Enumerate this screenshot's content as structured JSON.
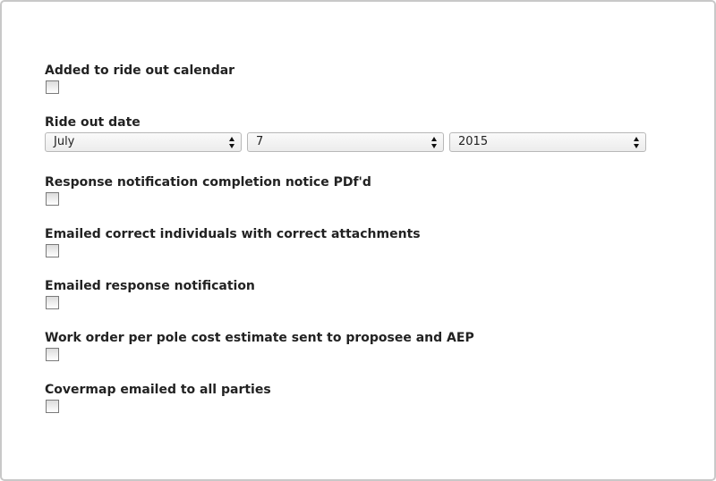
{
  "form": {
    "added_to_calendar": {
      "label": "Added to ride out calendar",
      "checked": false
    },
    "ride_out_date": {
      "label": "Ride out date",
      "month": "July",
      "day": "7",
      "year": "2015"
    },
    "response_pdf": {
      "label": "Response notification completion notice PDf'd",
      "checked": false
    },
    "emailed_individuals": {
      "label": "Emailed correct individuals with correct attachments",
      "checked": false
    },
    "emailed_response": {
      "label": "Emailed response notification",
      "checked": false
    },
    "work_order": {
      "label": "Work order per pole cost estimate sent to proposee and AEP",
      "checked": false
    },
    "covermap": {
      "label": "Covermap emailed to all parties",
      "checked": false
    }
  },
  "icons": {
    "select_arrows": "up-down-arrows-icon"
  },
  "colors": {
    "border": "#c8c8c8",
    "text": "#222222",
    "select_border": "#b8b8b8"
  }
}
